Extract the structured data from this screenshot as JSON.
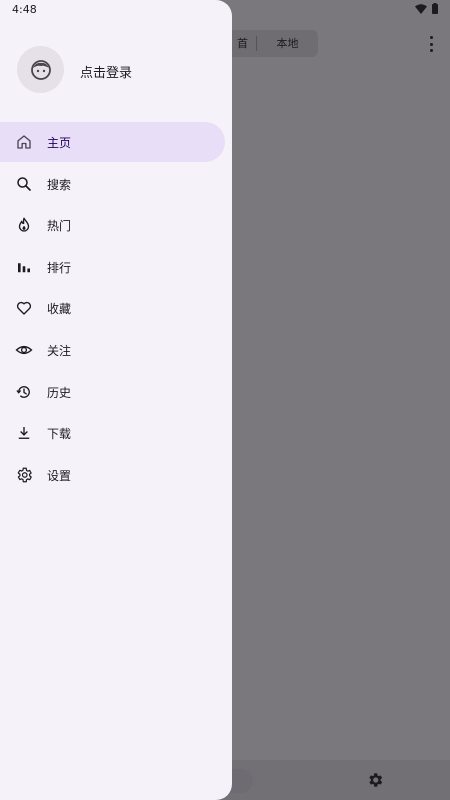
{
  "status": {
    "time": "4:48"
  },
  "background": {
    "segment": {
      "left_label": "首",
      "right_label": "本地"
    }
  },
  "drawer": {
    "login_label": "点击登录",
    "items": [
      {
        "label": "主页",
        "icon": "home-icon",
        "active": true
      },
      {
        "label": "搜索",
        "icon": "search-icon",
        "active": false
      },
      {
        "label": "热门",
        "icon": "fire-icon",
        "active": false
      },
      {
        "label": "排行",
        "icon": "bar-chart-icon",
        "active": false
      },
      {
        "label": "收藏",
        "icon": "heart-icon",
        "active": false
      },
      {
        "label": "关注",
        "icon": "eye-icon",
        "active": false
      },
      {
        "label": "历史",
        "icon": "history-icon",
        "active": false
      },
      {
        "label": "下载",
        "icon": "download-icon",
        "active": false
      },
      {
        "label": "设置",
        "icon": "gear-icon",
        "active": false
      }
    ]
  },
  "colors": {
    "drawer_bg": "#f6f2fa",
    "active_bg": "#e8def8",
    "scrim": "#7a787c",
    "text": "#1c1b1f"
  }
}
